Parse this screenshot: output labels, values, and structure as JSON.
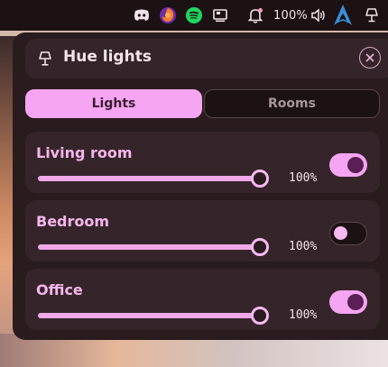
{
  "topbar": {
    "tray_icons": [
      "discord-icon",
      "firefox-icon",
      "spotify-icon",
      "screen-icon"
    ],
    "notification_icon": "bell-icon",
    "volume_text": "100%",
    "launcher_icon": "arch-icon",
    "lights_icon": "lamp-icon"
  },
  "panel": {
    "title": "Hue lights",
    "tabs": [
      {
        "label": "Lights",
        "active": true
      },
      {
        "label": "Rooms",
        "active": false
      }
    ],
    "rooms": [
      {
        "name": "Living room",
        "brightness_label": "100%",
        "brightness": 1.0,
        "on": true
      },
      {
        "name": "Bedroom",
        "brightness_label": "100%",
        "brightness": 1.0,
        "on": false
      },
      {
        "name": "Office",
        "brightness_label": "100%",
        "brightness": 1.0,
        "on": true
      }
    ]
  },
  "colors": {
    "accent": "#f6a5f2",
    "panel_bg": "#2a1c1e",
    "card_bg": "#35252a",
    "topbar_bg": "#1c1214"
  }
}
